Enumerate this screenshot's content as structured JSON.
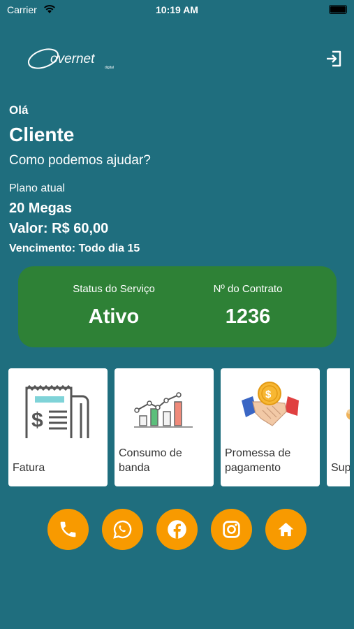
{
  "status_bar": {
    "carrier": "Carrier",
    "time": "10:19 AM"
  },
  "brand": {
    "logo_text": "overnet",
    "logo_subtext": "digital"
  },
  "greeting": {
    "hello": "Olá",
    "name": "Cliente",
    "question": "Como podemos ajudar?"
  },
  "plan": {
    "label": "Plano atual",
    "name": "20 Megas",
    "value": "Valor: R$ 60,00",
    "due": "Vencimento: Todo dia 15"
  },
  "status_card": {
    "status_label": "Status do Serviço",
    "status_value": "Ativo",
    "contract_label": "Nº do Contrato",
    "contract_value": "1236"
  },
  "cards": [
    {
      "label": "Fatura",
      "icon": "invoice-icon"
    },
    {
      "label": "Consumo de banda",
      "icon": "bandwidth-chart-icon"
    },
    {
      "label": "Promessa de pagamento",
      "icon": "handshake-coin-icon"
    },
    {
      "label": "Suporte",
      "icon": "support-icon"
    }
  ],
  "social": [
    "phone-icon",
    "whatsapp-icon",
    "facebook-icon",
    "instagram-icon",
    "home-icon"
  ],
  "colors": {
    "background": "#1f6e7e",
    "status_card": "#2e8136",
    "accent": "#f89a00"
  }
}
